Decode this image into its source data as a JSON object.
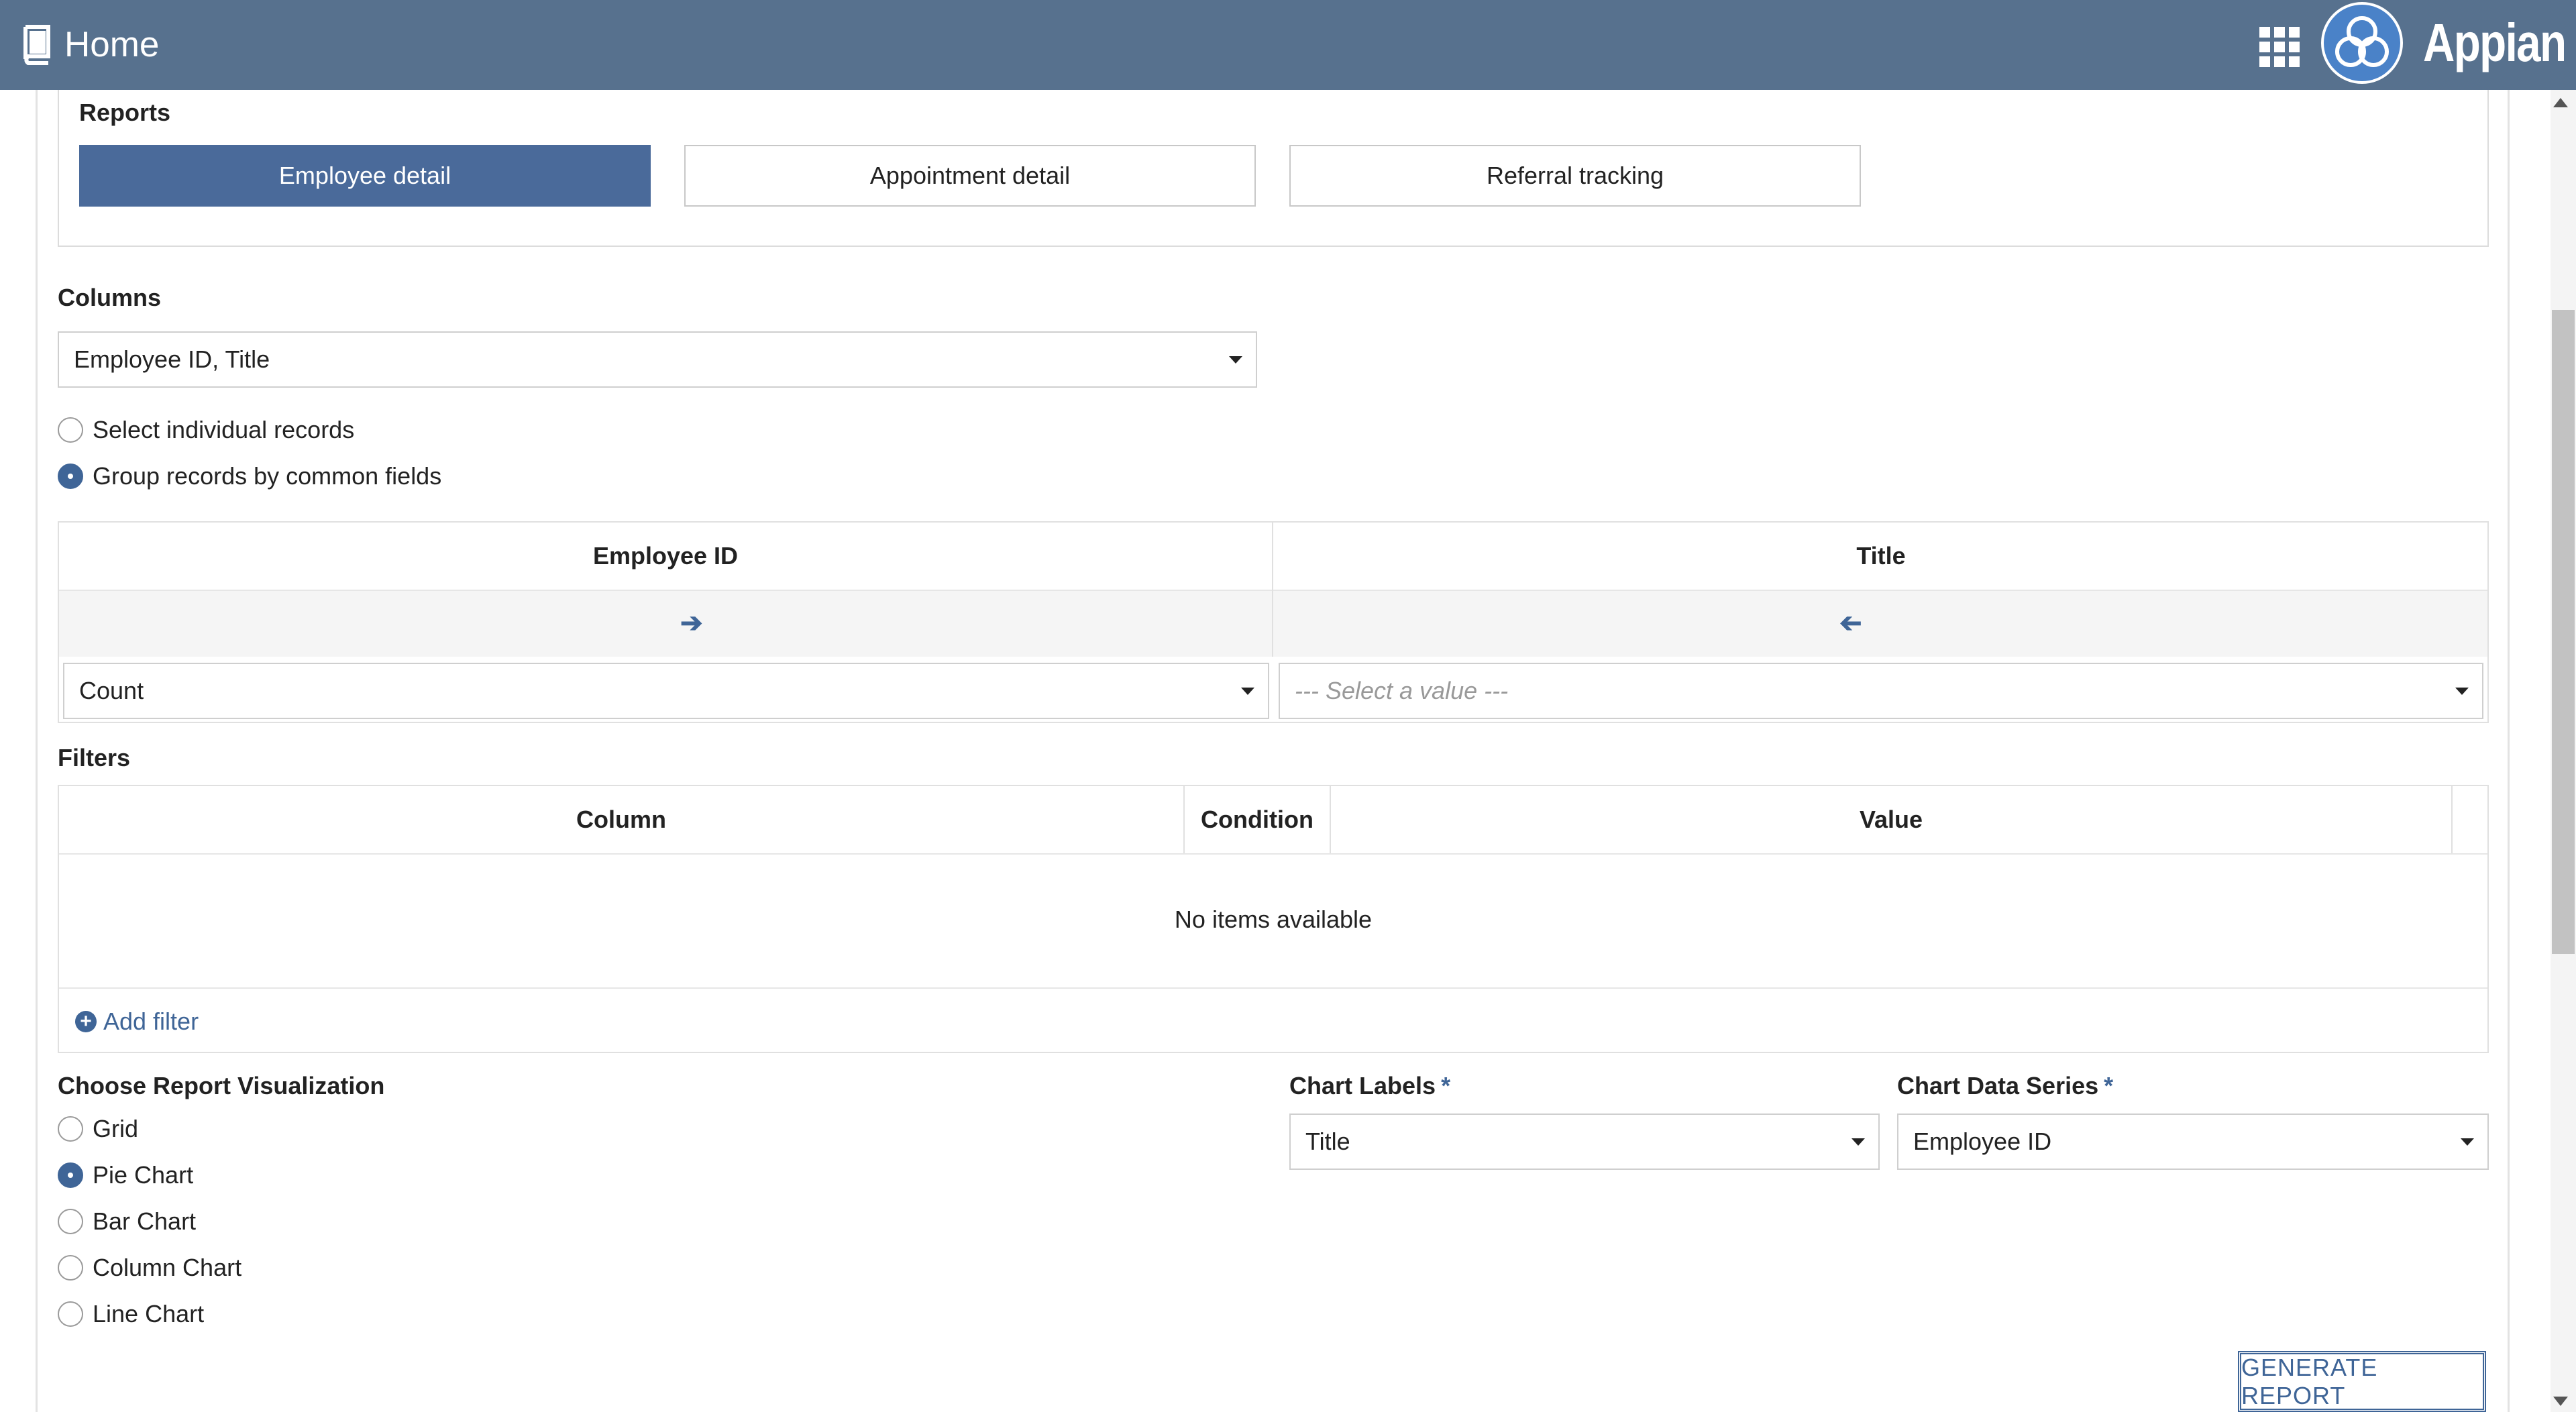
{
  "header": {
    "title": "Home",
    "brand": "Appian"
  },
  "reports": {
    "label": "Reports",
    "buttons": [
      {
        "label": "Employee detail",
        "selected": true
      },
      {
        "label": "Appointment detail",
        "selected": false
      },
      {
        "label": "Referral tracking",
        "selected": false
      }
    ]
  },
  "columns": {
    "label": "Columns",
    "value": "Employee ID, Title"
  },
  "record_mode": {
    "options": [
      {
        "label": "Select individual records",
        "checked": false
      },
      {
        "label": "Group records by common fields",
        "checked": true
      }
    ]
  },
  "group_table": {
    "headers": [
      "Employee ID",
      "Title"
    ],
    "aggregations": [
      {
        "value": "Count",
        "placeholder": false
      },
      {
        "value": "--- Select a value ---",
        "placeholder": true
      }
    ]
  },
  "filters": {
    "label": "Filters",
    "headers": [
      "Column",
      "Condition",
      "Value"
    ],
    "empty_text": "No items available",
    "add_label": "Add filter"
  },
  "visualization": {
    "label": "Choose Report Visualization",
    "options": [
      {
        "label": "Grid",
        "checked": false
      },
      {
        "label": "Pie Chart",
        "checked": true
      },
      {
        "label": "Bar Chart",
        "checked": false
      },
      {
        "label": "Column Chart",
        "checked": false
      },
      {
        "label": "Line Chart",
        "checked": false
      }
    ]
  },
  "chart_labels": {
    "label": "Chart Labels",
    "required": "*",
    "value": "Title"
  },
  "chart_series": {
    "label": "Chart Data Series",
    "required": "*",
    "value": "Employee ID"
  },
  "generate_button": "GENERATE REPORT",
  "colors": {
    "header": "#57718e",
    "accent": "#3f6597",
    "selected_button": "#4a6a9a"
  }
}
